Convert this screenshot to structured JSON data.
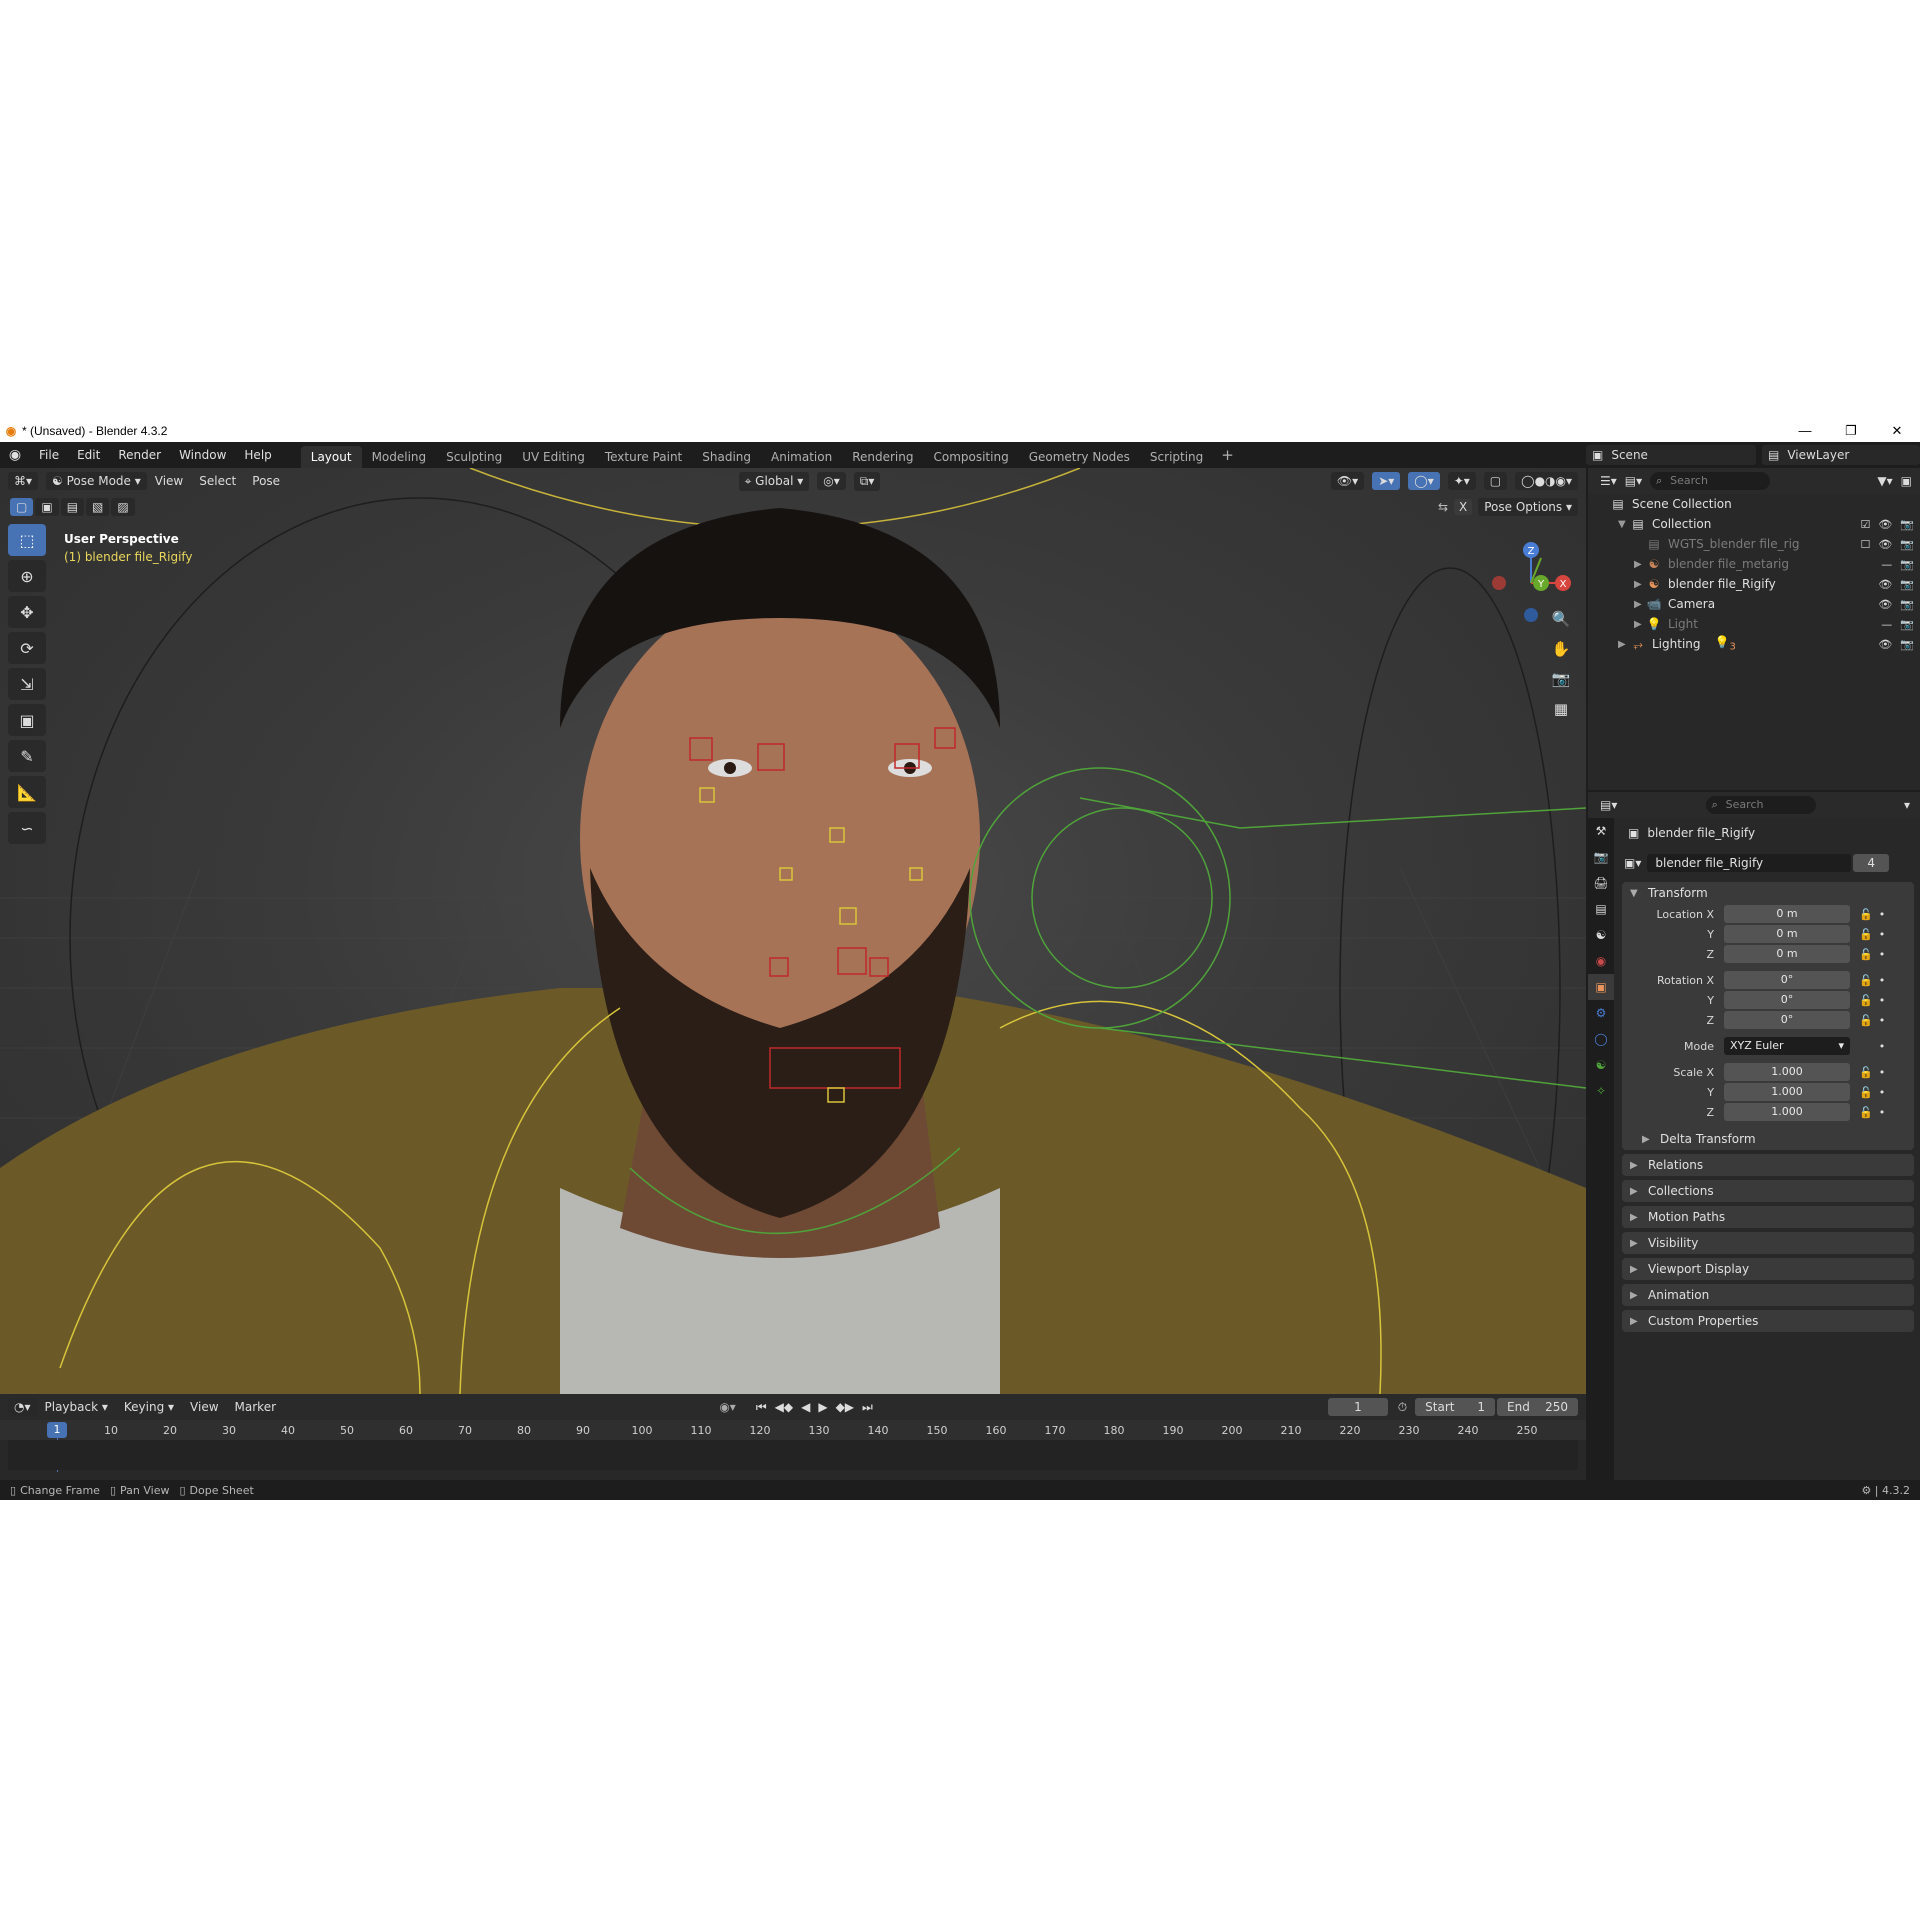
{
  "window": {
    "title": "* (Unsaved) - Blender 4.3.2",
    "controls": [
      "—",
      "❐",
      "✕"
    ]
  },
  "menu": {
    "items": [
      "File",
      "Edit",
      "Render",
      "Window",
      "Help"
    ],
    "workspaces": [
      "Layout",
      "Modeling",
      "Sculpting",
      "UV Editing",
      "Texture Paint",
      "Shading",
      "Animation",
      "Rendering",
      "Compositing",
      "Geometry Nodes",
      "Scripting"
    ],
    "active_workspace": "Layout",
    "scene": "Scene",
    "view_layer": "ViewLayer"
  },
  "viewport": {
    "mode": "Pose Mode",
    "menus": [
      "View",
      "Select",
      "Pose"
    ],
    "transform_orientation": "Global",
    "perspective_label": "User Perspective",
    "object_label": "(1) blender file_Rigify",
    "pose_options": "Pose Options",
    "mirror_axis": "X",
    "gizmo_axes": {
      "x": "X",
      "y": "Y",
      "z": "Z"
    }
  },
  "toolbar": {
    "tools": [
      "select-box",
      "cursor",
      "move",
      "rotate",
      "scale",
      "transform",
      "annotate",
      "measure",
      "bone-envelope"
    ]
  },
  "outliner": {
    "search_placeholder": "Search",
    "root": "Scene Collection",
    "collection": "Collection",
    "items": [
      {
        "name": "WGTS_blender file_rig",
        "dim": true
      },
      {
        "name": "blender file_metarig",
        "dim": true
      },
      {
        "name": "blender file_Rigify",
        "dim": false
      },
      {
        "name": "Camera",
        "dim": false
      },
      {
        "name": "Light",
        "dim": true
      }
    ],
    "lighting": "Lighting",
    "lighting_count": "3"
  },
  "properties": {
    "search_placeholder": "Search",
    "object_name": "blender file_Rigify",
    "datablock_name": "blender file_Rigify",
    "user_count": "4",
    "transform": {
      "title": "Transform",
      "location_label": "Location X",
      "location": [
        "0 m",
        "0 m",
        "0 m"
      ],
      "rotation_label": "Rotation X",
      "rotation": [
        "0°",
        "0°",
        "0°"
      ],
      "mode_label": "Mode",
      "mode": "XYZ Euler",
      "scale_label": "Scale X",
      "scale": [
        "1.000",
        "1.000",
        "1.000"
      ],
      "y": "Y",
      "z": "Z",
      "delta": "Delta Transform"
    },
    "panels": [
      "Relations",
      "Collections",
      "Motion Paths",
      "Visibility",
      "Viewport Display",
      "Animation",
      "Custom Properties"
    ]
  },
  "timeline": {
    "menus": [
      "Playback",
      "Keying",
      "View",
      "Marker"
    ],
    "current_frame": "1",
    "start_label": "Start",
    "start": "1",
    "end_label": "End",
    "end": "250",
    "ruler": [
      "10",
      "20",
      "30",
      "40",
      "50",
      "60",
      "70",
      "80",
      "90",
      "100",
      "110",
      "120",
      "130",
      "140",
      "150",
      "160",
      "170",
      "180",
      "190",
      "200",
      "210",
      "220",
      "230",
      "240",
      "250"
    ]
  },
  "statusbar": {
    "hints": [
      "Change Frame",
      "Pan View",
      "Dope Sheet"
    ],
    "version": "4.3.2"
  },
  "colors": {
    "accent": "#4772b3",
    "bone_yellow": "#d8c43a",
    "bone_green": "#4fa33a",
    "bone_red": "#c0282a",
    "active_object_text": "#e9d75c"
  }
}
